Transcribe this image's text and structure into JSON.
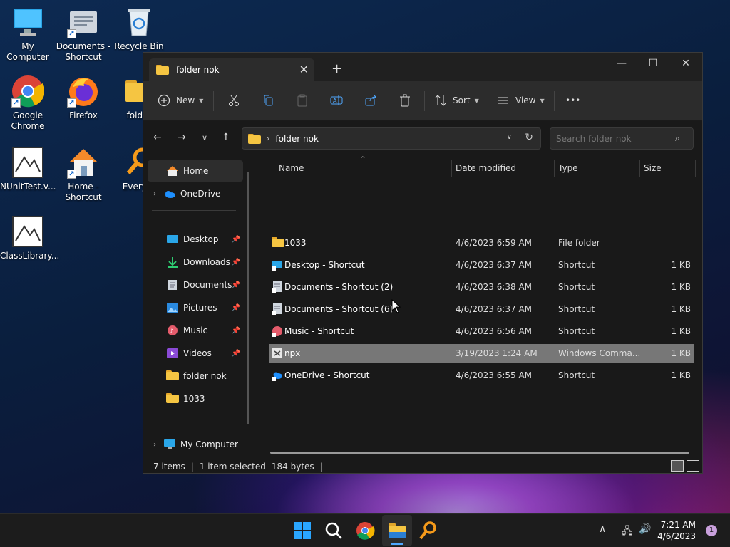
{
  "desktop": {
    "icons": [
      {
        "label": "My Computer"
      },
      {
        "label": "Documents - Shortcut"
      },
      {
        "label": "Recycle Bin"
      },
      {
        "label": "Google Chrome"
      },
      {
        "label": "Firefox"
      },
      {
        "label": "folder"
      },
      {
        "label": "NUnitTest.v..."
      },
      {
        "label": "Home - Shortcut"
      },
      {
        "label": "Everyth"
      },
      {
        "label": "ClassLibrary..."
      }
    ]
  },
  "window": {
    "tab_title": "folder nok",
    "new_tab": "+",
    "controls": {
      "minimize": "—",
      "maximize": "☐",
      "close": "✕"
    }
  },
  "toolbar": {
    "new_label": "New",
    "sort_label": "Sort",
    "view_label": "View",
    "more_label": "•••"
  },
  "address": {
    "path": "folder nok",
    "search_placeholder": "Search folder nok"
  },
  "sidebar": {
    "items": [
      {
        "label": "Home"
      },
      {
        "label": "OneDrive"
      },
      {
        "label": "Desktop"
      },
      {
        "label": "Downloads"
      },
      {
        "label": "Documents"
      },
      {
        "label": "Pictures"
      },
      {
        "label": "Music"
      },
      {
        "label": "Videos"
      },
      {
        "label": "folder nok"
      },
      {
        "label": "1033"
      },
      {
        "label": "My Computer"
      }
    ]
  },
  "columns": {
    "name": "Name",
    "date": "Date modified",
    "type": "Type",
    "size": "Size"
  },
  "files": [
    {
      "name": "1033",
      "date": "4/6/2023 6:59 AM",
      "type": "File folder",
      "size": ""
    },
    {
      "name": "Desktop - Shortcut",
      "date": "4/6/2023 6:37 AM",
      "type": "Shortcut",
      "size": "1 KB"
    },
    {
      "name": "Documents - Shortcut (2)",
      "date": "4/6/2023 6:38 AM",
      "type": "Shortcut",
      "size": "1 KB"
    },
    {
      "name": "Documents - Shortcut (6)",
      "date": "4/6/2023 6:37 AM",
      "type": "Shortcut",
      "size": "1 KB"
    },
    {
      "name": "Music - Shortcut",
      "date": "4/6/2023 6:56 AM",
      "type": "Shortcut",
      "size": "1 KB"
    },
    {
      "name": "npx",
      "date": "3/19/2023 1:24 AM",
      "type": "Windows Comma...",
      "size": "1 KB"
    },
    {
      "name": "OneDrive - Shortcut",
      "date": "4/6/2023 6:55 AM",
      "type": "Shortcut",
      "size": "1 KB"
    }
  ],
  "status": {
    "items": "7 items",
    "selected": "1 item selected",
    "size": "184 bytes",
    "sep": "|"
  },
  "taskbar": {
    "time": "7:21 AM",
    "date": "4/6/2023",
    "notifications": "1"
  },
  "colors": {
    "accent": "#0078d4",
    "folder": "#f5c542",
    "selection": "#777777"
  }
}
